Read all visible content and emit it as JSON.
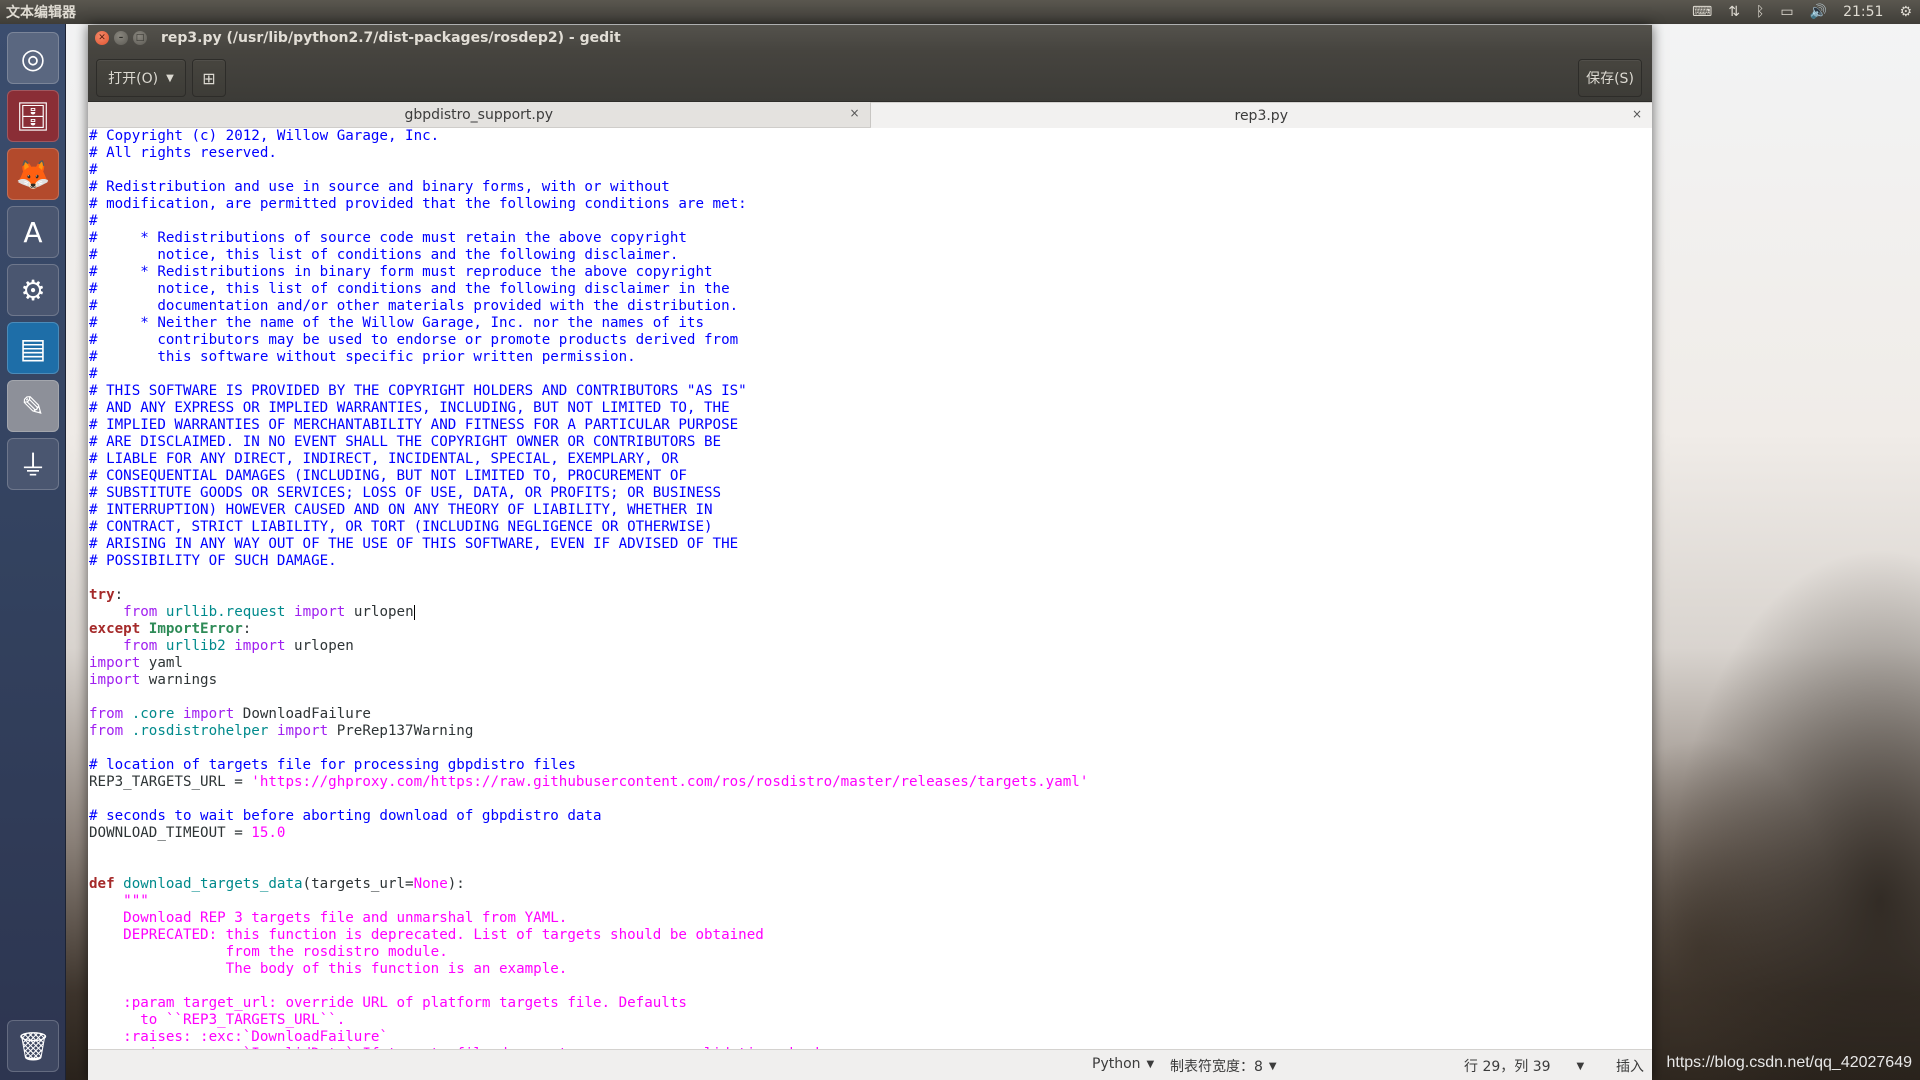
{
  "top_panel": {
    "app_name": "文本编辑器",
    "indicators": [
      {
        "icon": "keyboard-icon",
        "glyph": "⌨"
      },
      {
        "icon": "network-transfer-icon",
        "glyph": "⇅"
      },
      {
        "icon": "bluetooth-icon",
        "glyph": "ᛒ"
      },
      {
        "icon": "battery-icon",
        "glyph": "▭"
      },
      {
        "icon": "volume-icon",
        "glyph": "🔊"
      },
      {
        "icon": "clock",
        "glyph": "21:51"
      },
      {
        "icon": "power-gear-icon",
        "glyph": "⚙"
      }
    ]
  },
  "launcher": {
    "items": [
      {
        "name": "ubuntu-dash",
        "icon": "ubuntu-logo-icon",
        "glyph": "◎",
        "color": "#5a6780"
      },
      {
        "name": "files",
        "icon": "file-cabinet-icon",
        "glyph": "🗄",
        "color": "#8a2e36"
      },
      {
        "name": "firefox",
        "icon": "firefox-icon",
        "glyph": "🦊",
        "color": "#b34a2c"
      },
      {
        "name": "software-center",
        "icon": "shopping-bag-icon",
        "glyph": "A",
        "color": "#4a5670"
      },
      {
        "name": "system-settings",
        "icon": "wrench-gear-icon",
        "glyph": "⚙",
        "color": "#4a5670"
      },
      {
        "name": "libreoffice-writer",
        "icon": "writer-document-icon",
        "glyph": "▤",
        "color": "#1e6ea8"
      },
      {
        "name": "text-editor",
        "icon": "pencil-document-icon",
        "glyph": "✎",
        "color": "#8d9099"
      },
      {
        "name": "usb-drive",
        "icon": "usb-drive-icon",
        "glyph": "⏚",
        "color": "#4a5670"
      }
    ],
    "trash": {
      "icon": "trash-icon",
      "glyph": "🗑"
    }
  },
  "window": {
    "title": "rep3.py (/usr/lib/python2.7/dist-packages/rosdep2) - gedit",
    "toolbar": {
      "open_label": "打开(O)",
      "new_document_icon": "new-document-icon",
      "save_label": "保存(S)"
    },
    "tabs": [
      {
        "label": "gbpdistro_support.py",
        "active": false
      },
      {
        "label": "rep3.py",
        "active": true
      }
    ],
    "code_lines": [
      [
        [
          "c-comment",
          "# Copyright (c) 2012, Willow Garage, Inc."
        ]
      ],
      [
        [
          "c-comment",
          "# All rights reserved."
        ]
      ],
      [
        [
          "c-comment",
          "#"
        ]
      ],
      [
        [
          "c-comment",
          "# Redistribution and use in source and binary forms, with or without"
        ]
      ],
      [
        [
          "c-comment",
          "# modification, are permitted provided that the following conditions are met:"
        ]
      ],
      [
        [
          "c-comment",
          "#"
        ]
      ],
      [
        [
          "c-comment",
          "#     * Redistributions of source code must retain the above copyright"
        ]
      ],
      [
        [
          "c-comment",
          "#       notice, this list of conditions and the following disclaimer."
        ]
      ],
      [
        [
          "c-comment",
          "#     * Redistributions in binary form must reproduce the above copyright"
        ]
      ],
      [
        [
          "c-comment",
          "#       notice, this list of conditions and the following disclaimer in the"
        ]
      ],
      [
        [
          "c-comment",
          "#       documentation and/or other materials provided with the distribution."
        ]
      ],
      [
        [
          "c-comment",
          "#     * Neither the name of the Willow Garage, Inc. nor the names of its"
        ]
      ],
      [
        [
          "c-comment",
          "#       contributors may be used to endorse or promote products derived from"
        ]
      ],
      [
        [
          "c-comment",
          "#       this software without specific prior written permission."
        ]
      ],
      [
        [
          "c-comment",
          "#"
        ]
      ],
      [
        [
          "c-comment",
          "# THIS SOFTWARE IS PROVIDED BY THE COPYRIGHT HOLDERS AND CONTRIBUTORS \"AS IS\""
        ]
      ],
      [
        [
          "c-comment",
          "# AND ANY EXPRESS OR IMPLIED WARRANTIES, INCLUDING, BUT NOT LIMITED TO, THE"
        ]
      ],
      [
        [
          "c-comment",
          "# IMPLIED WARRANTIES OF MERCHANTABILITY AND FITNESS FOR A PARTICULAR PURPOSE"
        ]
      ],
      [
        [
          "c-comment",
          "# ARE DISCLAIMED. IN NO EVENT SHALL THE COPYRIGHT OWNER OR CONTRIBUTORS BE"
        ]
      ],
      [
        [
          "c-comment",
          "# LIABLE FOR ANY DIRECT, INDIRECT, INCIDENTAL, SPECIAL, EXEMPLARY, OR"
        ]
      ],
      [
        [
          "c-comment",
          "# CONSEQUENTIAL DAMAGES (INCLUDING, BUT NOT LIMITED TO, PROCUREMENT OF"
        ]
      ],
      [
        [
          "c-comment",
          "# SUBSTITUTE GOODS OR SERVICES; LOSS OF USE, DATA, OR PROFITS; OR BUSINESS"
        ]
      ],
      [
        [
          "c-comment",
          "# INTERRUPTION) HOWEVER CAUSED AND ON ANY THEORY OF LIABILITY, WHETHER IN"
        ]
      ],
      [
        [
          "c-comment",
          "# CONTRACT, STRICT LIABILITY, OR TORT (INCLUDING NEGLIGENCE OR OTHERWISE)"
        ]
      ],
      [
        [
          "c-comment",
          "# ARISING IN ANY WAY OUT OF THE USE OF THIS SOFTWARE, EVEN IF ADVISED OF THE"
        ]
      ],
      [
        [
          "c-comment",
          "# POSSIBILITY OF SUCH DAMAGE."
        ]
      ],
      [],
      [
        [
          "c-kw",
          "try"
        ],
        [
          "",
          ":"
        ]
      ],
      [
        [
          "",
          "    "
        ],
        [
          "c-imp",
          "from"
        ],
        [
          "",
          " "
        ],
        [
          "c-mod",
          "urllib.request"
        ],
        [
          "",
          " "
        ],
        [
          "c-imp",
          "import"
        ],
        [
          "",
          " urlopen"
        ],
        [
          "cursor",
          ""
        ]
      ],
      [
        [
          "c-kw",
          "except"
        ],
        [
          "",
          " "
        ],
        [
          "c-exc",
          "ImportError"
        ],
        [
          "",
          ":"
        ]
      ],
      [
        [
          "",
          "    "
        ],
        [
          "c-imp",
          "from"
        ],
        [
          "",
          " "
        ],
        [
          "c-mod",
          "urllib2"
        ],
        [
          "",
          " "
        ],
        [
          "c-imp",
          "import"
        ],
        [
          "",
          " urlopen"
        ]
      ],
      [
        [
          "c-imp",
          "import"
        ],
        [
          "",
          " yaml"
        ]
      ],
      [
        [
          "c-imp",
          "import"
        ],
        [
          "",
          " warnings"
        ]
      ],
      [],
      [
        [
          "c-imp",
          "from"
        ],
        [
          "",
          " "
        ],
        [
          "c-mod",
          ".core"
        ],
        [
          "",
          " "
        ],
        [
          "c-imp",
          "import"
        ],
        [
          "",
          " DownloadFailure"
        ]
      ],
      [
        [
          "c-imp",
          "from"
        ],
        [
          "",
          " "
        ],
        [
          "c-mod",
          ".rosdistrohelper"
        ],
        [
          "",
          " "
        ],
        [
          "c-imp",
          "import"
        ],
        [
          "",
          " PreRep137Warning"
        ]
      ],
      [],
      [
        [
          "c-comment",
          "# location of targets file for processing gbpdistro files"
        ]
      ],
      [
        [
          "",
          "REP3_TARGETS_URL = "
        ],
        [
          "c-str",
          "'https://ghproxy.com/https://raw.githubusercontent.com/ros/rosdistro/master/releases/targets.yaml'"
        ]
      ],
      [],
      [
        [
          "c-comment",
          "# seconds to wait before aborting download of gbpdistro data"
        ]
      ],
      [
        [
          "",
          "DOWNLOAD_TIMEOUT = "
        ],
        [
          "c-str",
          "15.0"
        ]
      ],
      [],
      [],
      [
        [
          "c-kw",
          "def"
        ],
        [
          "",
          " "
        ],
        [
          "c-fn",
          "download_targets_data"
        ],
        [
          "",
          "(targets_url="
        ],
        [
          "c-str",
          "None"
        ],
        [
          "",
          "):"
        ]
      ],
      [
        [
          "c-str",
          "    \"\"\""
        ]
      ],
      [
        [
          "c-str",
          "    Download REP 3 targets file and unmarshal from YAML."
        ]
      ],
      [
        [
          "c-str",
          "    DEPRECATED: this function is deprecated. List of targets should be obtained"
        ]
      ],
      [
        [
          "c-str",
          "                from the rosdistro module."
        ]
      ],
      [
        [
          "c-str",
          "                The body of this function is an example."
        ]
      ],
      [],
      [
        [
          "c-str",
          "    :param target_url: override URL of platform targets file. Defaults"
        ]
      ],
      [
        [
          "c-str",
          "      to ``REP3_TARGETS_URL``."
        ]
      ],
      [
        [
          "c-str",
          "    :raises: :exc:`DownloadFailure`"
        ]
      ],
      [
        [
          "c-str",
          "    :raises: :exc:`InvalidData` If targets file does not pass cursory validation checks."
        ]
      ]
    ],
    "statusbar": {
      "language": "Python",
      "tab_width": "制表符宽度：8",
      "position": "行 29，列 39",
      "mode": "插入"
    }
  },
  "watermark": "https://blog.csdn.net/qq_42027649"
}
